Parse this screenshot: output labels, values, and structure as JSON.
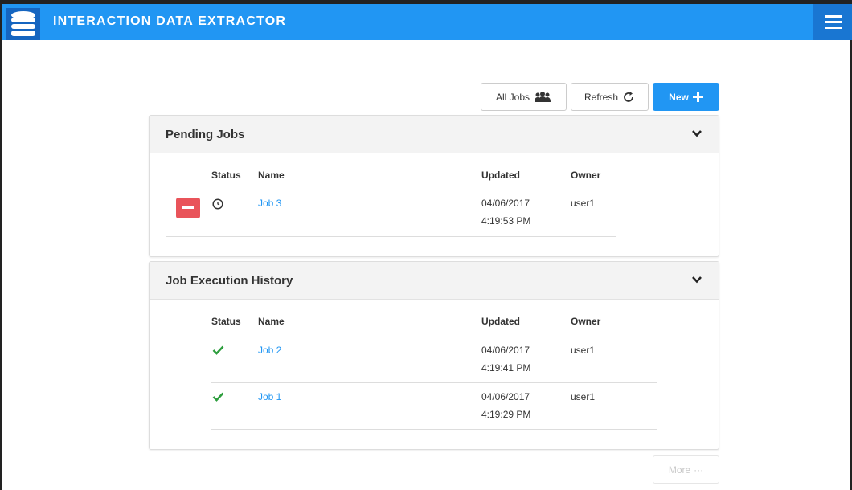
{
  "header": {
    "title": "INTERACTION DATA EXTRACTOR",
    "logo_icon": "database-icon",
    "menu_icon": "hamburger-menu-icon"
  },
  "toolbar": {
    "all_jobs_label": "All Jobs",
    "all_jobs_icon": "users-icon",
    "refresh_label": "Refresh",
    "refresh_icon": "refresh-icon",
    "new_label": "New",
    "new_icon": "plus-icon"
  },
  "pending": {
    "title": "Pending Jobs",
    "columns": {
      "status": "Status",
      "name": "Name",
      "updated": "Updated",
      "owner": "Owner"
    },
    "rows": [
      {
        "status_icon": "clock-icon",
        "name": "Job 3",
        "date": "04/06/2017",
        "time": "4:19:53 PM",
        "owner": "user1"
      }
    ]
  },
  "history": {
    "title": "Job Execution History",
    "columns": {
      "status": "Status",
      "name": "Name",
      "updated": "Updated",
      "owner": "Owner"
    },
    "rows": [
      {
        "status_icon": "check-icon",
        "name": "Job 2",
        "date": "04/06/2017",
        "time": "4:19:41 PM",
        "owner": "user1"
      },
      {
        "status_icon": "check-icon",
        "name": "Job 1",
        "date": "04/06/2017",
        "time": "4:19:29 PM",
        "owner": "user1"
      }
    ]
  },
  "more": {
    "label": "More",
    "icon": "ellipsis-icon"
  },
  "colors": {
    "primary": "#2196f3",
    "danger": "#e9545a",
    "success": "#2e9e3e"
  }
}
